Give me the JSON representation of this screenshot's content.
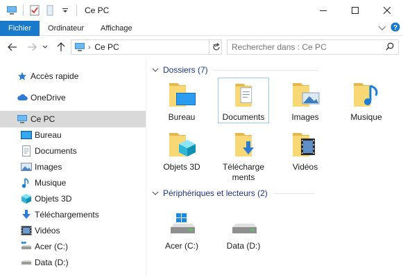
{
  "window": {
    "title": "Ce PC"
  },
  "ribbon": {
    "tabs": [
      "Fichier",
      "Ordinateur",
      "Affichage"
    ]
  },
  "address": {
    "crumb": "Ce PC"
  },
  "search": {
    "placeholder": "Rechercher dans : Ce PC"
  },
  "sidebar": {
    "items": [
      {
        "label": "Accès rapide",
        "icon": "star-icon"
      },
      {
        "label": "OneDrive",
        "icon": "cloud-icon"
      },
      {
        "label": "Ce PC",
        "icon": "computer-icon",
        "selected": true
      },
      {
        "label": "Bureau",
        "icon": "desktop-icon"
      },
      {
        "label": "Documents",
        "icon": "documents-icon"
      },
      {
        "label": "Images",
        "icon": "pictures-icon"
      },
      {
        "label": "Musique",
        "icon": "music-icon"
      },
      {
        "label": "Objets 3D",
        "icon": "objects-3d-icon"
      },
      {
        "label": "Téléchargements",
        "icon": "download-icon"
      },
      {
        "label": "Vidéos",
        "icon": "videos-icon"
      },
      {
        "label": "Acer (C:)",
        "icon": "drive-c-icon"
      },
      {
        "label": "Data (D:)",
        "icon": "drive-d-icon"
      }
    ]
  },
  "folders": {
    "header": "Dossiers (7)",
    "items": [
      "Bureau",
      "Documents",
      "Images",
      "Musique",
      "Objets 3D",
      "Téléchargements",
      "Vidéos"
    ]
  },
  "devices": {
    "header": "Périphériques et lecteurs (2)",
    "items": [
      "Acer (C:)",
      "Data (D:)"
    ]
  },
  "colors": {
    "accent": "#1979ca",
    "group_header": "#1e3287",
    "folder": "#f8d775",
    "selected_bg": "#d9d9d9"
  }
}
